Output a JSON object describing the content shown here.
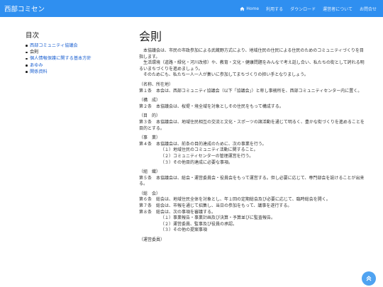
{
  "site": {
    "brand": "西部コミセン"
  },
  "nav": {
    "items": [
      {
        "label": "Home",
        "icon": "home-icon"
      },
      {
        "label": "利用する"
      },
      {
        "label": "ダウンロード"
      },
      {
        "label": "運営者について"
      },
      {
        "label": "お問合せ"
      }
    ]
  },
  "sidebar": {
    "title": "目次",
    "items": [
      {
        "label": "西部コミュニティ協議会",
        "state": "link"
      },
      {
        "label": "会則",
        "state": "current"
      },
      {
        "label": "個人情報保護に関する基本方針",
        "state": "link"
      },
      {
        "label": "あゆみ",
        "state": "link"
      },
      {
        "label": "関係資料",
        "state": "link"
      }
    ]
  },
  "main": {
    "title": "会則",
    "intro": [
      "本協議会は、市民の市政参加による武蔵野方式により、地域住民の住民による住民のためのコミュニティづくりを目指します。",
      "生活環境（道路・緑化・河川改修）や、教育・文化・健康問題をみんなで考え話し合い、私たちの街として誇れる明るいまちづくりを進めましょう。",
      "そのためにも、私たち一人一人が集いに参加してまちづくりの担い手となりましょう。"
    ],
    "sections": [
      {
        "heading": "（名称、所在地）",
        "articles": [
          "第１条　本会は、西部コミュニティ協議会（以下「協議会」）と称し事務所を、西部コミュニティセンター内に置く。"
        ],
        "subs": []
      },
      {
        "heading": "（構　成）",
        "articles": [
          "第２条　本協議会は、桜堤・境全域を対象としその住民をもって構成する。"
        ],
        "subs": []
      },
      {
        "heading": "（目　的）",
        "articles": [
          "第３条　本協議会は、地域住民相互の交流と文化・スポーツの諸活動を通じて明るく、豊かな街づくりを進めることを目的とする。"
        ],
        "subs": []
      },
      {
        "heading": "（事　業）",
        "articles": [
          "第４条　本協議会は、前条の目的達成のために、次の事業を行う。"
        ],
        "subs": [
          "（１）地域住民のコミュニティ活動に関すること。",
          "（２）コミュニティセンターの管理運営を行う。",
          "（３）その他目的達成に必要な事項。"
        ]
      },
      {
        "heading": "（組　織）",
        "articles": [
          "第５条　本協議会は、総会・運営委員会・役員会をもって運営する。但し必要に応じて、専門部会を設けることが出来る。"
        ],
        "subs": []
      },
      {
        "heading": "（総　会）",
        "articles": [
          "第６条　総会は、地域住民全体を対象とし、年１回の定期総会及び必要に応じて、臨時総会を開く。",
          "第７条　総会は、市報を通じて招集し、当日の参加をもって、議事を遂行する。",
          "第８条　総会は、次の事項を審議する。"
        ],
        "subs": [
          "（１）事業報告・事業計画及び決算・予算並びに監査報告。",
          "（２）運営委員、監事及び役員の承認。",
          "（３）その他の提案事項"
        ]
      },
      {
        "heading": "（運営委員）",
        "articles": [],
        "subs": []
      }
    ]
  },
  "colors": {
    "navbar": "#2f8ff0",
    "link": "#1a5fd0",
    "scroll_button": "#4fa3f1"
  },
  "scroll_top": {
    "icon": "double-chevron-up-icon"
  }
}
